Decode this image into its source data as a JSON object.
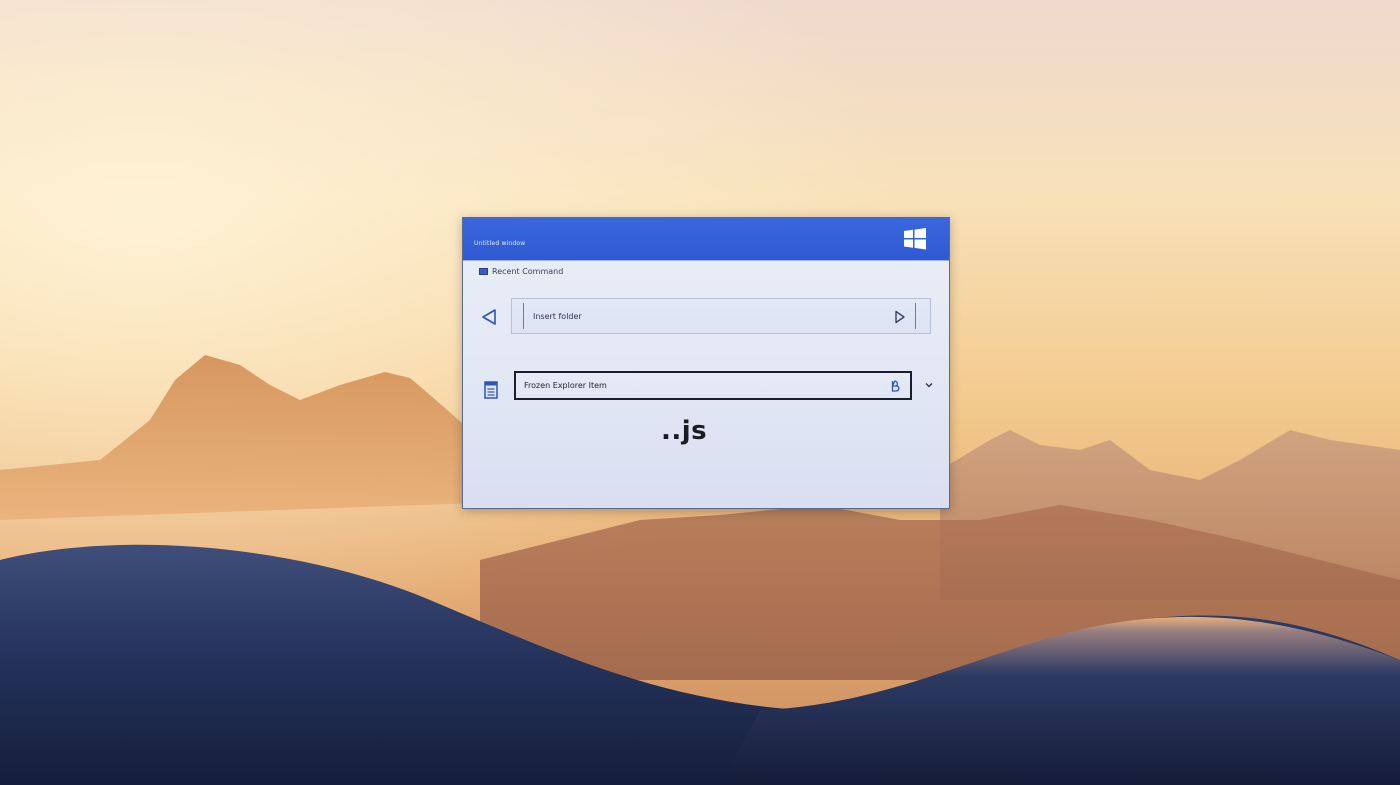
{
  "window": {
    "title": "Untitled window",
    "section_label": "Recent Command",
    "path_text": "Insert folder",
    "field_text": "Frozen Explorer Item",
    "extension_label": "..js"
  },
  "icons": {
    "windows_logo": "windows-logo-icon",
    "back": "triangle-left-icon",
    "forward": "triangle-right-icon",
    "document": "document-icon",
    "field_action": "small-b-icon",
    "dropdown": "chevron-down-icon"
  },
  "colors": {
    "titlebar": "#3162d8",
    "accent": "#2f59d2",
    "window_bg": "#e6ebf6"
  }
}
